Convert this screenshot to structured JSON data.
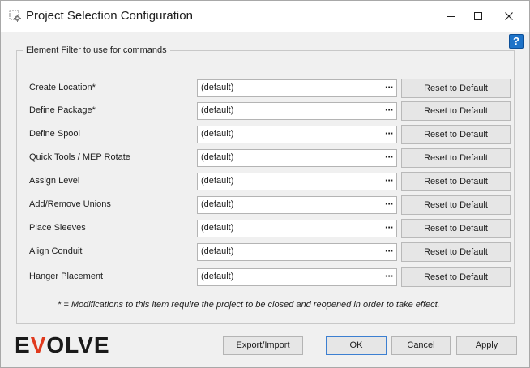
{
  "window": {
    "title": "Project Selection Configuration",
    "help_label": "?"
  },
  "group": {
    "legend": "Element Filter to use for commands"
  },
  "rows": [
    {
      "label": "Create Location*",
      "value": "(default)",
      "reset_label": "Reset to Default"
    },
    {
      "label": "Define Package*",
      "value": "(default)",
      "reset_label": "Reset to Default"
    },
    {
      "label": "Define Spool",
      "value": "(default)",
      "reset_label": "Reset to Default"
    },
    {
      "label": "Quick Tools / MEP Rotate",
      "value": "(default)",
      "reset_label": "Reset to Default"
    },
    {
      "label": "Assign Level",
      "value": "(default)",
      "reset_label": "Reset to Default"
    },
    {
      "label": "Add/Remove Unions",
      "value": "(default)",
      "reset_label": "Reset to Default"
    },
    {
      "label": "Place Sleeves",
      "value": "(default)",
      "reset_label": "Reset to Default"
    },
    {
      "label": "Align Conduit",
      "value": "(default)",
      "reset_label": "Reset to Default"
    },
    {
      "label": "Hanger Placement",
      "value": "(default)",
      "reset_label": "Reset to Default"
    }
  ],
  "browse_glyph": "···",
  "note": "* = Modifications to this item require the project to be closed and reopened in order to take effect.",
  "logo": {
    "pre": "E",
    "accent": "V",
    "post": "OLVE",
    "accent_color": "#e03a1e"
  },
  "buttons": {
    "export_import": "Export/Import",
    "ok": "OK",
    "cancel": "Cancel",
    "apply": "Apply"
  },
  "icons": {
    "app": "settings-gear-icon",
    "minimize": "minimize-icon",
    "maximize": "maximize-icon",
    "close": "close-icon",
    "help": "help-icon"
  }
}
